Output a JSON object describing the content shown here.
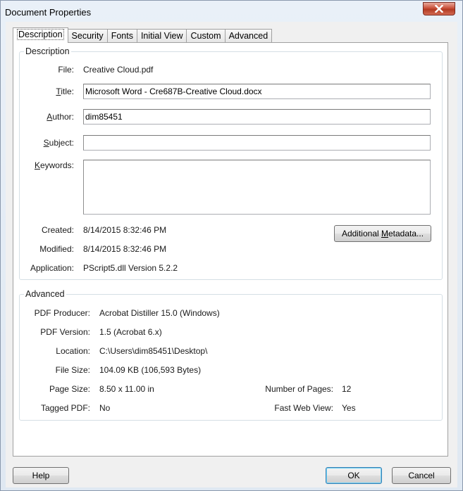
{
  "window": {
    "title": "Document Properties"
  },
  "tabs": [
    {
      "label": "Description"
    },
    {
      "label": "Security"
    },
    {
      "label": "Fonts"
    },
    {
      "label": "Initial View"
    },
    {
      "label": "Custom"
    },
    {
      "label": "Advanced"
    }
  ],
  "description": {
    "group_title": "Description",
    "file_label": "File:",
    "file_value": "Creative Cloud.pdf",
    "title_label_pre": "",
    "title_label_key": "T",
    "title_label_post": "itle:",
    "title_value": "Microsoft Word - Cre687B-Creative Cloud.docx",
    "author_label_key": "A",
    "author_label_post": "uthor:",
    "author_value": "dim85451",
    "subject_label_key": "S",
    "subject_label_post": "ubject:",
    "subject_value": "",
    "keywords_label_key": "K",
    "keywords_label_post": "eywords:",
    "keywords_value": "",
    "created_label": "Created:",
    "created_value": "8/14/2015 8:32:46 PM",
    "modified_label": "Modified:",
    "modified_value": "8/14/2015 8:32:46 PM",
    "application_label": "Application:",
    "application_value": "PScript5.dll Version 5.2.2",
    "metadata_button_pre": "Additional ",
    "metadata_button_key": "M",
    "metadata_button_post": "etadata..."
  },
  "advanced": {
    "group_title": "Advanced",
    "pdf_producer_label": "PDF Producer:",
    "pdf_producer_value": "Acrobat Distiller 15.0 (Windows)",
    "pdf_version_label": "PDF Version:",
    "pdf_version_value": "1.5 (Acrobat 6.x)",
    "location_label": "Location:",
    "location_value": "C:\\Users\\dim85451\\Desktop\\",
    "file_size_label": "File Size:",
    "file_size_value": "104.09 KB (106,593 Bytes)",
    "page_size_label": "Page Size:",
    "page_size_value": "8.50 x 11.00 in",
    "tagged_pdf_label": "Tagged PDF:",
    "tagged_pdf_value": "No",
    "num_pages_label": "Number of Pages:",
    "num_pages_value": "12",
    "fast_web_label": "Fast Web View:",
    "fast_web_value": "Yes"
  },
  "buttons": {
    "help": "Help",
    "ok": "OK",
    "cancel": "Cancel"
  },
  "icons": {
    "close": "close-icon"
  }
}
